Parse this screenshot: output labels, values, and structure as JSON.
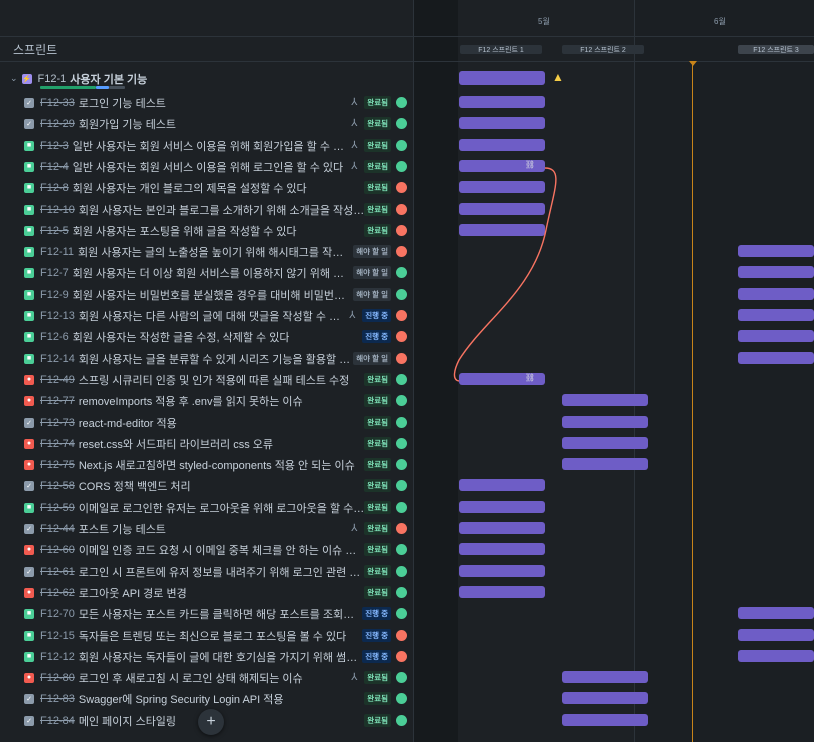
{
  "header": {
    "column_label": "스프린트"
  },
  "timeline": {
    "months": [
      "5월",
      "6월"
    ],
    "sprints": [
      "F12 스프린트 1",
      "F12 스프린트 2",
      "F12 스프린트 3"
    ]
  },
  "epic": {
    "key": "F12-1",
    "title": "사용자 기본 기능"
  },
  "rows": [
    {
      "type": "task",
      "key": "F12-33",
      "done": true,
      "title": "로그인 기능 테스트",
      "child": true,
      "status": "완료됨",
      "sc": "done",
      "av": "g"
    },
    {
      "type": "task",
      "key": "F12-29",
      "done": true,
      "title": "회원가입 기능 테스트",
      "child": true,
      "status": "완료됨",
      "sc": "done",
      "av": "g"
    },
    {
      "type": "story",
      "key": "F12-3",
      "done": true,
      "title": "일반 사용자는 회원 서비스 이용을 위해 회원가입을 할 수 있다",
      "child": true,
      "status": "완료됨",
      "sc": "done",
      "av": "g"
    },
    {
      "type": "story",
      "key": "F12-4",
      "done": true,
      "title": "일반 사용자는 회원 서비스 이용을 위해 로그인을 할 수 있다",
      "child": true,
      "status": "완료됨",
      "sc": "done",
      "av": "g"
    },
    {
      "type": "story",
      "key": "F12-8",
      "done": true,
      "title": "회원 사용자는 개인 블로그의 제목을 설정할 수 있다",
      "child": false,
      "status": "완료됨",
      "sc": "done",
      "av": "o"
    },
    {
      "type": "story",
      "key": "F12-10",
      "done": true,
      "title": "회원 사용자는 본인과 블로그를 소개하기 위해 소개글을 작성할...",
      "child": false,
      "status": "완료됨",
      "sc": "done",
      "av": "o"
    },
    {
      "type": "story",
      "key": "F12-5",
      "done": true,
      "title": "회원 사용자는 포스팅을 위해 글을 작성할 수 있다",
      "child": false,
      "status": "완료됨",
      "sc": "done",
      "av": "o"
    },
    {
      "type": "story",
      "key": "F12-11",
      "done": false,
      "title": "회원 사용자는 글의 노출성을 높이기 위해 해시태그를 작성할...",
      "child": false,
      "status": "해야 할 일",
      "sc": "todo",
      "av": "o"
    },
    {
      "type": "story",
      "key": "F12-7",
      "done": false,
      "title": "회원 사용자는 더 이상 회원 서비스를 이용하지 않기 위해 회원...",
      "child": false,
      "status": "해야 할 일",
      "sc": "todo",
      "av": "g"
    },
    {
      "type": "story",
      "key": "F12-9",
      "done": false,
      "title": "회원 사용자는 비밀번호를 분실했을 경우를 대비해 비밀번호 ...",
      "child": false,
      "status": "해야 할 일",
      "sc": "todo",
      "av": "g"
    },
    {
      "type": "story",
      "key": "F12-13",
      "done": false,
      "title": "회원 사용자는 다른 사람의 글에 대해 댓글을 작성할 수 있다",
      "child": true,
      "status": "진행 중",
      "sc": "prog",
      "av": "o"
    },
    {
      "type": "story",
      "key": "F12-6",
      "done": false,
      "title": "회원 사용자는 작성한 글을 수정, 삭제할 수 있다",
      "child": false,
      "status": "진행 중",
      "sc": "prog",
      "av": "o"
    },
    {
      "type": "story",
      "key": "F12-14",
      "done": false,
      "title": "회원 사용자는 글을 분류할 수 있게 시리즈 기능을 활용할 수 ...",
      "child": false,
      "status": "해야 할 일",
      "sc": "todo",
      "av": "o"
    },
    {
      "type": "bug",
      "key": "F12-49",
      "done": true,
      "title": "스프링 시큐리티 인증 및 인가 적용에 따른 실패 테스트 수정",
      "child": false,
      "status": "완료됨",
      "sc": "done",
      "av": "g"
    },
    {
      "type": "bug",
      "key": "F12-77",
      "done": true,
      "title": "removeImports 적용 후 .env를 읽지 못하는 이슈",
      "child": false,
      "status": "완료됨",
      "sc": "done",
      "av": "g"
    },
    {
      "type": "task",
      "key": "F12-73",
      "done": true,
      "title": "react-md-editor 적용",
      "child": false,
      "status": "완료됨",
      "sc": "done",
      "av": "g"
    },
    {
      "type": "bug",
      "key": "F12-74",
      "done": true,
      "title": "reset.css와 서드파티 라이브러리 css 오류",
      "child": false,
      "status": "완료됨",
      "sc": "done",
      "av": "g"
    },
    {
      "type": "bug",
      "key": "F12-75",
      "done": true,
      "title": "Next.js 새로고침하면 styled-components 적용 안 되는 이슈",
      "child": false,
      "status": "완료됨",
      "sc": "done",
      "av": "g"
    },
    {
      "type": "task",
      "key": "F12-58",
      "done": true,
      "title": "CORS 정책 백엔드 처리",
      "child": false,
      "status": "완료됨",
      "sc": "done",
      "av": "g"
    },
    {
      "type": "story",
      "key": "F12-59",
      "done": true,
      "title": "이메일로 로그인한 유저는 로그아웃을 위해 로그아웃을 할 수 ...",
      "child": false,
      "status": "완료됨",
      "sc": "done",
      "av": "g"
    },
    {
      "type": "task",
      "key": "F12-44",
      "done": true,
      "title": "포스트 기능 테스트",
      "child": true,
      "status": "완료됨",
      "sc": "done",
      "av": "o"
    },
    {
      "type": "bug",
      "key": "F12-60",
      "done": true,
      "title": "이메일 인증 코드 요청 시 이메일 중복 체크를 안 하는 이슈 처리",
      "child": false,
      "status": "완료됨",
      "sc": "done",
      "av": "g"
    },
    {
      "type": "task",
      "key": "F12-61",
      "done": true,
      "title": "로그인 시 프론트에 유저 정보를 내려주기 위해 로그인 관련 로...",
      "child": false,
      "status": "완료됨",
      "sc": "done",
      "av": "g"
    },
    {
      "type": "bug",
      "key": "F12-62",
      "done": true,
      "title": "로그아웃 API 경로 변경",
      "child": false,
      "status": "완료됨",
      "sc": "done",
      "av": "g"
    },
    {
      "type": "story",
      "key": "F12-70",
      "done": false,
      "title": "모든 사용자는 포스트 카드를 클릭하면 해당 포스트를 조회할 ...",
      "child": false,
      "status": "진행 중",
      "sc": "prog",
      "av": "g"
    },
    {
      "type": "story",
      "key": "F12-15",
      "done": false,
      "title": "독자들은 트렌딩 또는 최신으로 블로그 포스팅을 볼 수 있다",
      "child": false,
      "status": "진행 중",
      "sc": "prog",
      "av": "o"
    },
    {
      "type": "story",
      "key": "F12-12",
      "done": false,
      "title": "회원 사용자는 독자들이 글에 대한 호기심을 가지기 위해 썸네...",
      "child": false,
      "status": "진행 중",
      "sc": "prog",
      "av": "o"
    },
    {
      "type": "bug",
      "key": "F12-80",
      "done": true,
      "title": "로그인 후 새로고침 시 로그인 상태 해제되는 이슈",
      "child": true,
      "status": "완료됨",
      "sc": "done",
      "av": "g"
    },
    {
      "type": "task",
      "key": "F12-83",
      "done": true,
      "title": "Swagger에 Spring Security Login API 적용",
      "child": false,
      "status": "완료됨",
      "sc": "done",
      "av": "g"
    },
    {
      "type": "task",
      "key": "F12-84",
      "done": true,
      "title": "메인 페이지 스타일링",
      "child": false,
      "status": "완료됨",
      "sc": "done",
      "av": "g"
    }
  ],
  "icons": {
    "expand": "chevron-down-icon",
    "warning": "warning-icon",
    "link": "link-icon",
    "child": "child-issues-icon",
    "add": "plus-icon"
  },
  "colors": {
    "bar": "#6e5dc6",
    "today_line": "#c8841a",
    "dependency": "#f87462"
  }
}
